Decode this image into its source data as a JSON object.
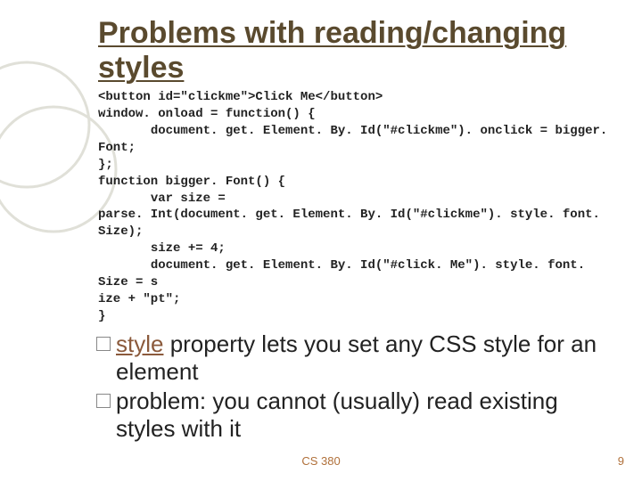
{
  "slide": {
    "title": "Problems with reading/changing styles",
    "code": "<button id=\"clickme\">Click Me</button>\nwindow. onload = function() {\n       document. get. Element. By. Id(\"#clickme\"). onclick = bigger. Font;\n};\nfunction bigger. Font() {\n       var size =\nparse. Int(document. get. Element. By. Id(\"#clickme\"). style. font. Size);\n       size += 4;\n       document. get. Element. By. Id(\"#click. Me\"). style. font. Size = s\nize + \"pt\";\n}",
    "bullets": [
      {
        "link": "style",
        "rest": " property lets you set any CSS style for an element"
      },
      {
        "link": "",
        "rest": "problem: you cannot (usually) read existing styles with it"
      }
    ],
    "footer": {
      "course": "CS 380",
      "number": "9"
    }
  }
}
